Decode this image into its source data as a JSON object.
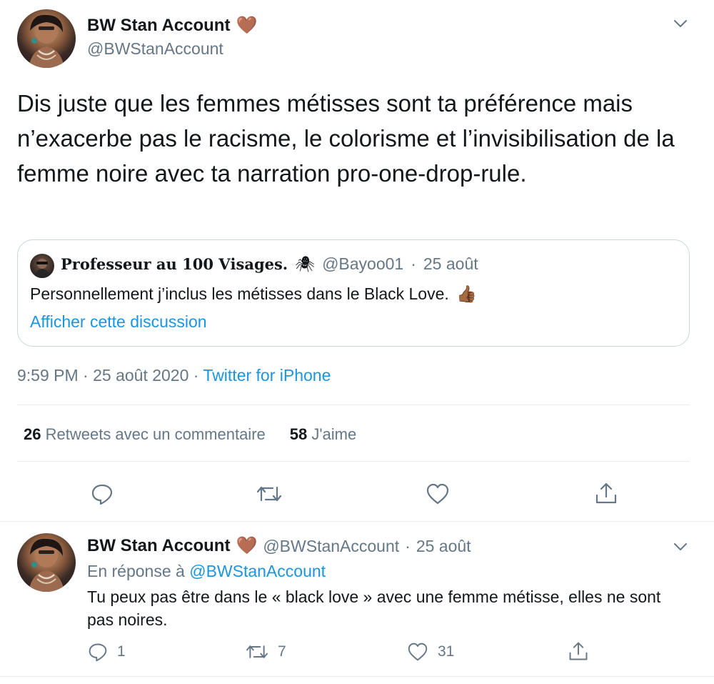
{
  "main_tweet": {
    "display_name": "BW Stan Account",
    "name_emoji": "🤎",
    "handle": "@BWStanAccount",
    "text": "Dis juste que les femmes métisses sont ta préférence mais n’exacerbe pas le racisme, le colorisme et l’invisibilisation de la femme noire avec ta narration pro-one-drop-rule.",
    "quoted": {
      "display_name": "𝐏𝐫𝐨𝐟𝐞𝐬𝐬𝐞𝐮𝐫 𝐚𝐮 𝟏𝟎𝟎 𝐕𝐢𝐬𝐚𝐠𝐞𝐬.",
      "name_emoji": "🕷",
      "handle": "@Bayoo01",
      "separator": "·",
      "date": "25 août",
      "text": "Personnellement j’inclus les métisses dans le Black Love.",
      "text_emoji": "👍🏾",
      "link_label": "Afficher cette discussion"
    },
    "timestamp": "9:59 PM · 25 août 2020 · ",
    "source": "Twitter for iPhone",
    "stats": {
      "retweets_count": "26",
      "retweets_label": "Retweets avec un commentaire",
      "likes_count": "58",
      "likes_label": "J'aime"
    },
    "actions": [
      "reply-icon",
      "retweet-icon",
      "like-icon",
      "share-icon"
    ]
  },
  "reply_tweet": {
    "display_name": "BW Stan Account",
    "name_emoji": "🤎",
    "handle": "@BWStanAccount",
    "separator": "·",
    "date": "25 août",
    "reply_prefix": "En réponse à ",
    "reply_to": "@BWStanAccount",
    "text": "Tu peux pas être dans le « black love » avec une femme métisse, elles ne sont pas noires.",
    "reply_count": "1",
    "retweet_count": "7",
    "like_count": "31"
  },
  "colors": {
    "text": "#14171a",
    "secondary": "#657786",
    "link": "#1b95e0",
    "border": "#e6ecf0",
    "heart_emoji": "#a0522d"
  }
}
